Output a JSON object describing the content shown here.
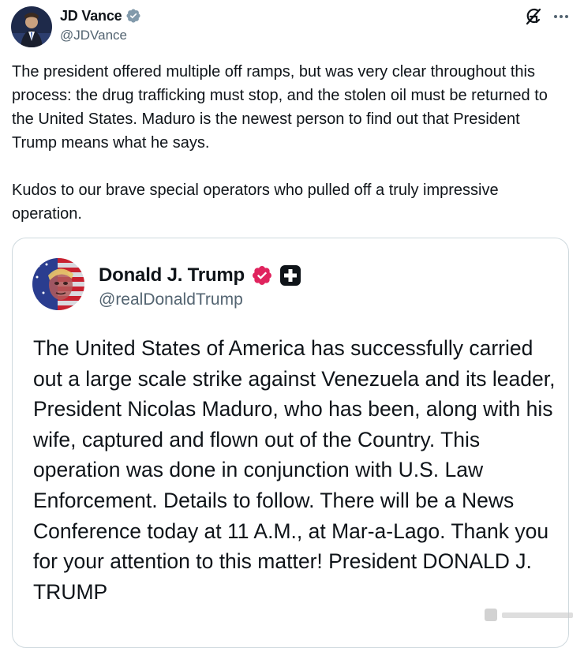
{
  "author": {
    "name": "JD Vance",
    "handle": "@JDVance",
    "verified_icon": "verified-badge-blue"
  },
  "header_actions": {
    "grok_icon": "grok-icon",
    "more_icon": "more-horizontal-icon"
  },
  "tweet": {
    "paragraphs": [
      "The president offered multiple off ramps, but was very clear throughout this process: the drug trafficking must stop, and the stolen oil must be returned to the United States. Maduro is the newest person to find out that President Trump means what he says.",
      "Kudos to our brave special operators who pulled off a truly impressive operation."
    ]
  },
  "quote": {
    "name": "Donald J. Trump",
    "handle": "@realDonaldTrump",
    "verified_icon": "verified-badge-red",
    "affiliate_icon": "plus-badge-icon",
    "text": "The United States of America has successfully carried out a large scale strike against Venezuela and its leader, President Nicolas Maduro, who has been, along with his wife, captured and flown out of the Country. This operation was done in conjunction with U.S. Law Enforcement. Details to follow. There will be a News Conference today at 11 A.M., at Mar-a-Lago. Thank you for your attention to this matter! President DONALD J. TRUMP"
  },
  "colors": {
    "text": "#0f1419",
    "secondary_text": "#536471",
    "verified_blue": "#1d9bf0",
    "verified_red": "#e0245e",
    "border": "#cfd9de"
  }
}
